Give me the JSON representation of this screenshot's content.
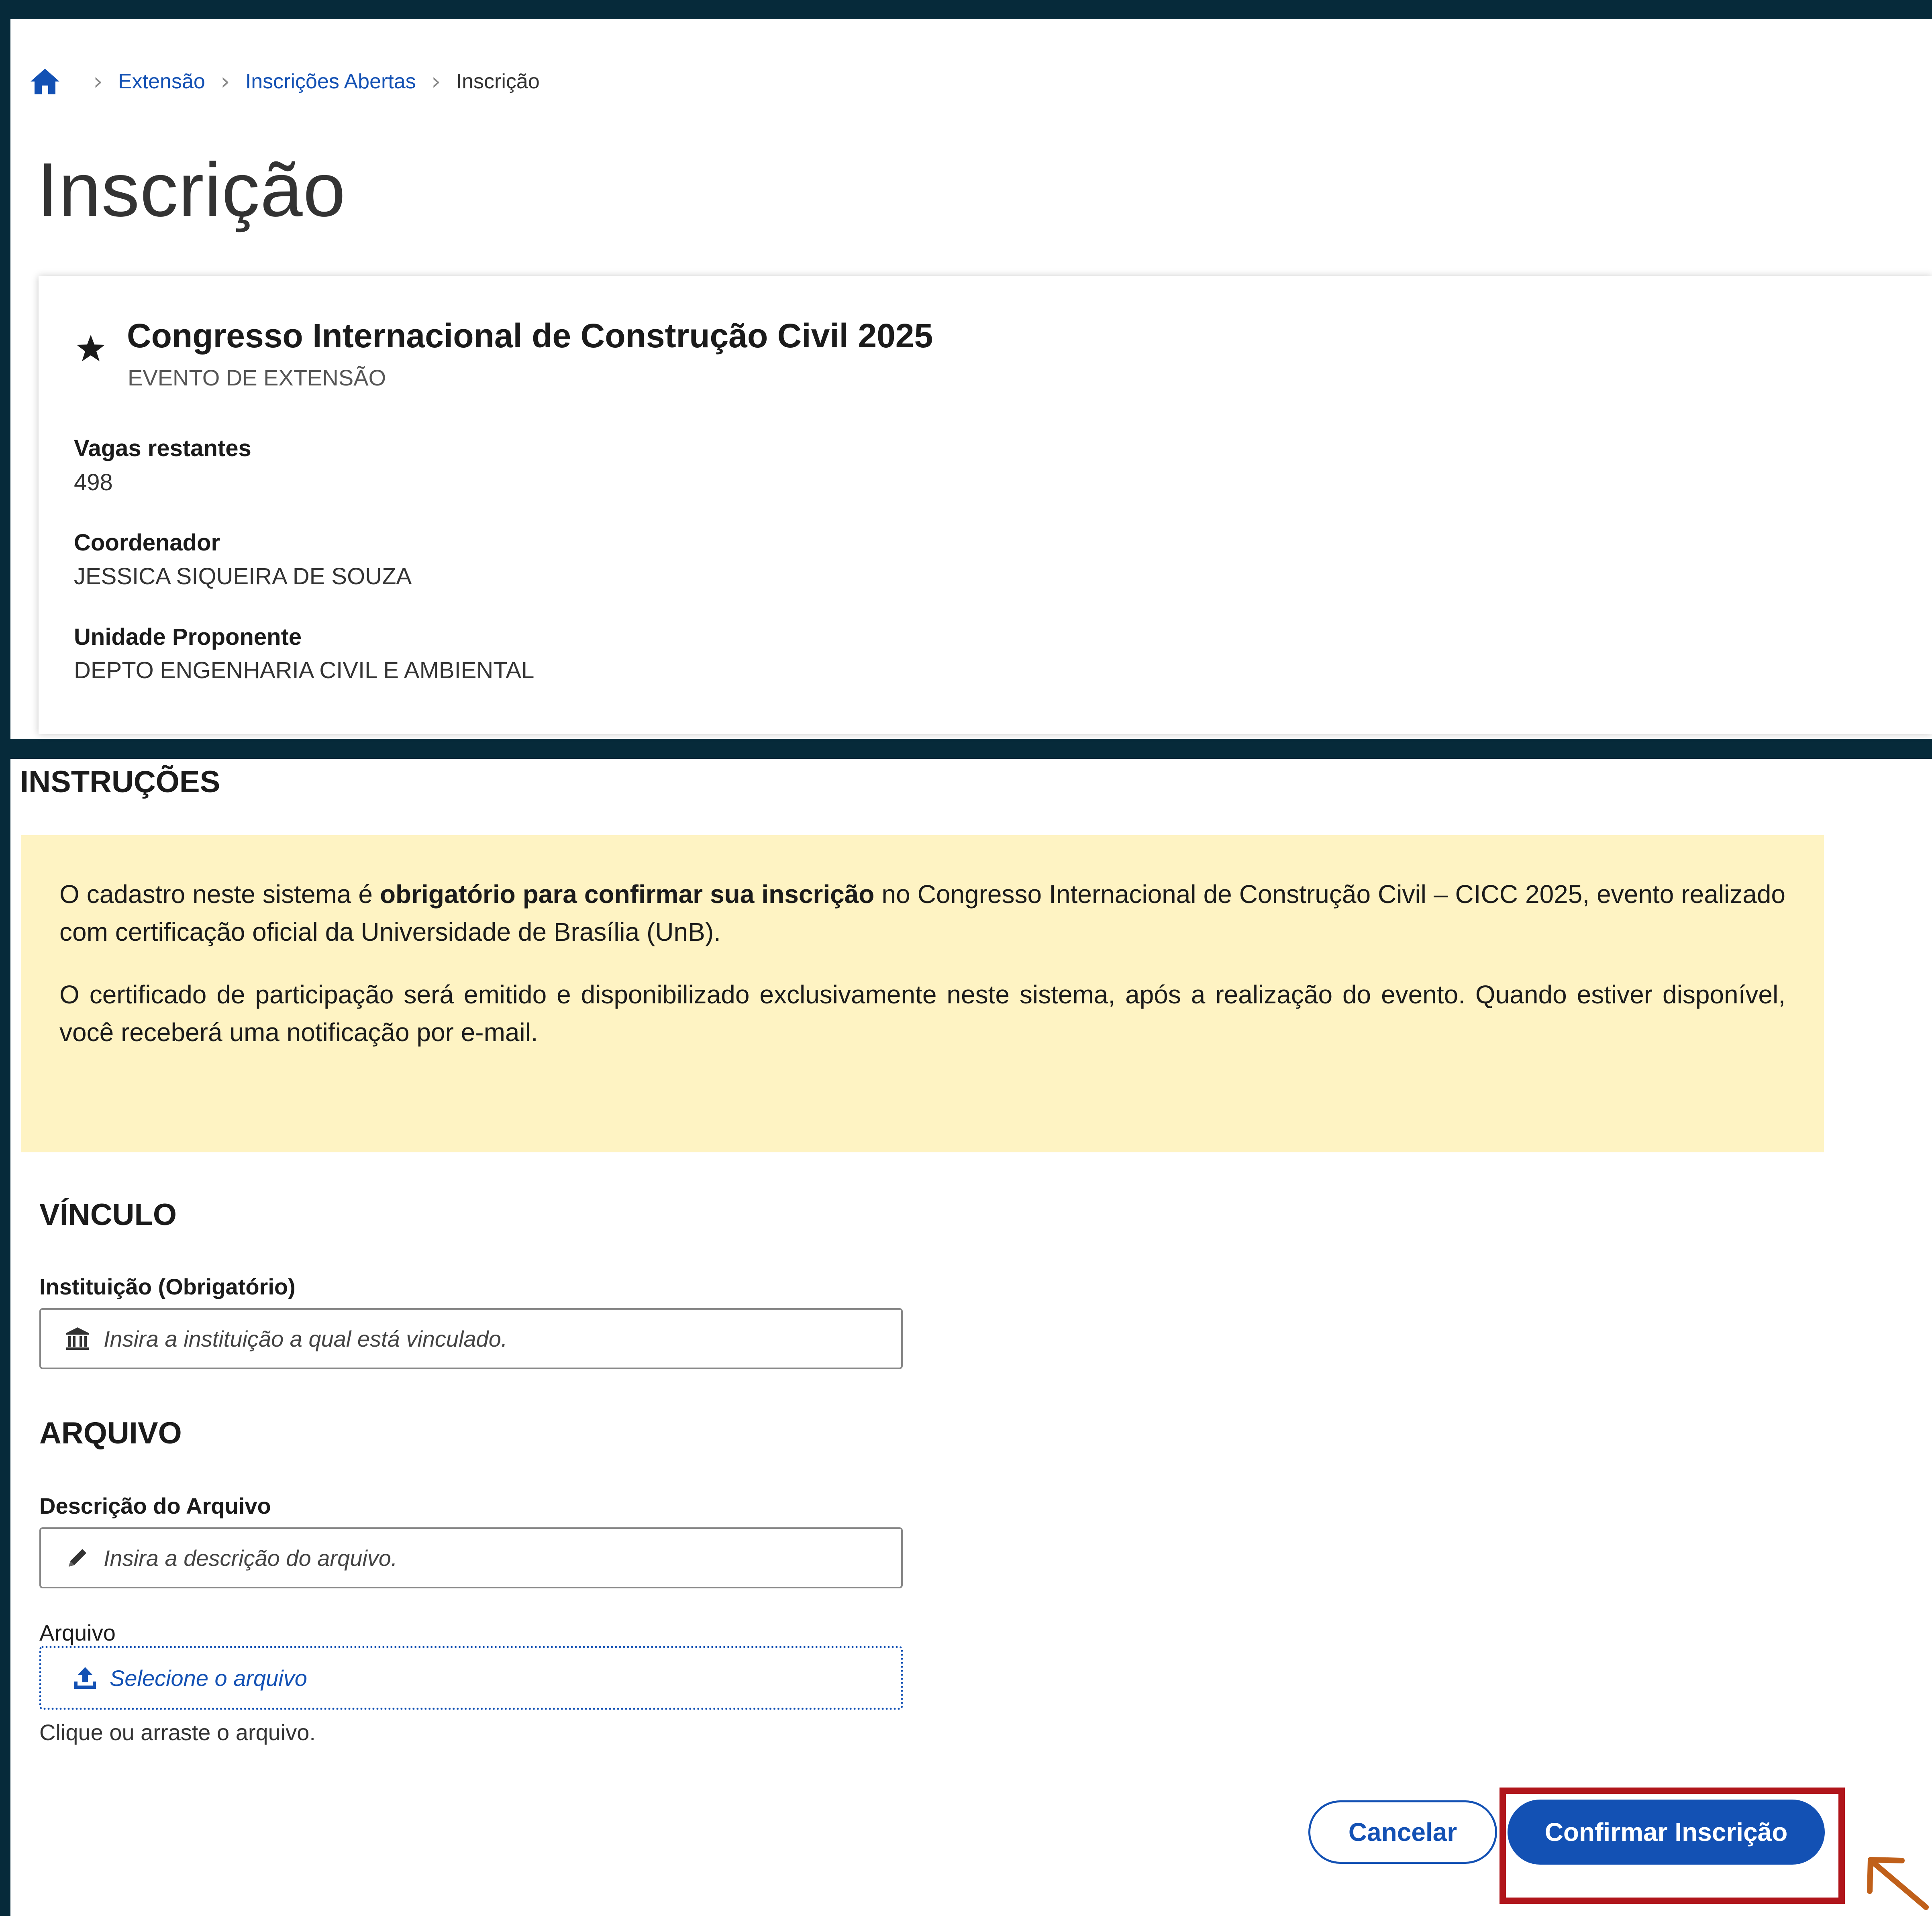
{
  "colors": {
    "frame": "#062a3a",
    "primary_blue": "#1351b4",
    "warning_bg": "#fef3c3",
    "highlight_red": "#b0151b",
    "arrow_orange": "#c0601a"
  },
  "breadcrumb": {
    "home_icon": "home-icon",
    "items": [
      "Extensão",
      "Inscrições Abertas",
      "Inscrição"
    ]
  },
  "page": {
    "title": "Inscrição"
  },
  "event": {
    "icon": "star-icon",
    "title": "Congresso Internacional de Construção Civil 2025",
    "subtitle": "EVENTO DE EXTENSÃO",
    "vagas_label": "Vagas restantes",
    "vagas_value": "498",
    "coordenador_label": "Coordenador",
    "coordenador_value": "JESSICA SIQUEIRA DE SOUZA",
    "unidade_label": "Unidade Proponente",
    "unidade_value": "DEPTO ENGENHARIA CIVIL E AMBIENTAL"
  },
  "instructions": {
    "heading": "INSTRUÇÕES",
    "p1_before": "O cadastro neste sistema é ",
    "p1_bold": "obrigatório para confirmar sua inscrição",
    "p1_after": " no Congresso Internacional de Construção Civil – CICC 2025, evento realizado com certificação oficial da Universidade de Brasília (UnB).",
    "p2": "O certificado de participação será emitido e disponibilizado exclusivamente neste sistema, após a realização do evento. Quando estiver disponível, você receberá uma notificação por e-mail."
  },
  "vinculo": {
    "heading": "VÍNCULO",
    "instituicao_label": "Instituição (Obrigatório)",
    "instituicao_placeholder": "Insira a instituição a qual está vinculado.",
    "instituicao_icon": "institution-icon"
  },
  "arquivo": {
    "heading": "ARQUIVO",
    "descricao_label": "Descrição do Arquivo",
    "descricao_placeholder": "Insira a descrição do arquivo.",
    "descricao_icon": "pencil-icon",
    "arquivo_label": "Arquivo",
    "upload_text": "Selecione o arquivo",
    "upload_icon": "upload-icon",
    "upload_help": "Clique ou arraste o arquivo."
  },
  "actions": {
    "cancel_label": "Cancelar",
    "confirm_label": "Confirmar Inscrição"
  }
}
